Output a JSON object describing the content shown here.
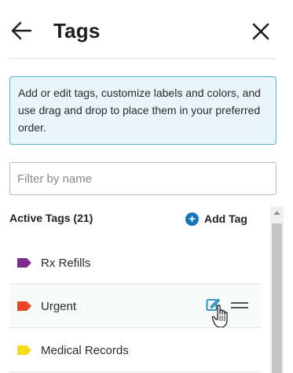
{
  "header": {
    "title": "Tags",
    "back_icon": "arrow-left-icon",
    "close_icon": "close-icon"
  },
  "info": {
    "text": "Add or edit tags, customize labels and colors, and use drag and drop to place them in your preferred order."
  },
  "filter": {
    "placeholder": "Filter by name",
    "value": ""
  },
  "list_header": {
    "active_label": "Active Tags (21)",
    "add_label": "Add Tag"
  },
  "tags": [
    {
      "name": "Rx Refills",
      "color": "#7b2e8e"
    },
    {
      "name": "Urgent",
      "color": "#e8452c"
    },
    {
      "name": "Medical Records",
      "color": "#f2dd1c"
    }
  ],
  "colors": {
    "accent": "#1673b8",
    "info_bg": "#e9f5fa",
    "info_border": "#55b3d1",
    "edit_icon": "#1e86b4"
  }
}
